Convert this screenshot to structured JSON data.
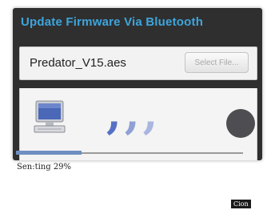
{
  "dialog": {
    "title": "Update Firmware Via Bluetooth",
    "file_name": "Predator_V15.aes",
    "select_button_label": "Select File..."
  },
  "transfer": {
    "source_icon": "computer-icon",
    "signal_glyphs": "‚‚‚",
    "signal_icon": "bluetooth-signal-icon",
    "target_icon": "device-icon",
    "progress_fraction": 0.29,
    "status_text": "Sen:ting  29%"
  },
  "corner_badge": "Cion",
  "colors": {
    "title": "#3ea5dd",
    "dialog_bg": "#2f2f2f",
    "progress_fill": "#6e8fbf"
  }
}
